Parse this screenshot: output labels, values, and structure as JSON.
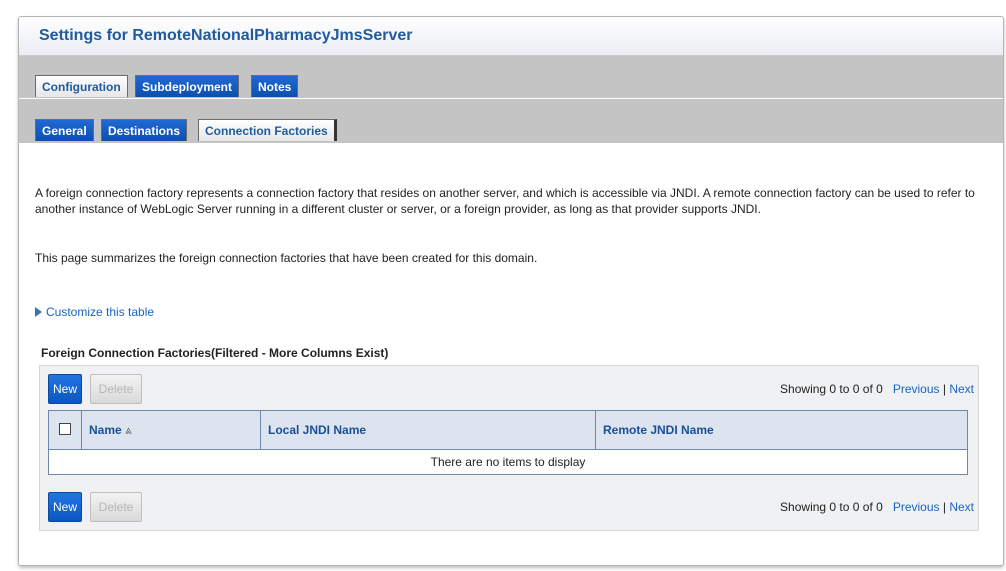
{
  "page_title": "Settings for RemoteNationalPharmacyJmsServer",
  "tabs_top": [
    {
      "label": "Configuration",
      "active": true
    },
    {
      "label": "Subdeployment",
      "active": false
    },
    {
      "label": "Notes",
      "active": false
    }
  ],
  "tabs_sub": [
    {
      "label": "General",
      "active": false
    },
    {
      "label": "Destinations",
      "active": false
    },
    {
      "label": "Connection Factories",
      "active": true
    }
  ],
  "description": "A foreign connection factory represents a connection factory that resides on another server, and which is accessible via JNDI. A remote connection factory can be used to refer to another instance of WebLogic Server running in a different cluster or server, or a foreign provider, as long as that provider supports JNDI.",
  "summary": "This page summarizes the foreign connection factories that have been created for this domain.",
  "customize_link": "Customize this table",
  "table": {
    "title": "Foreign Connection Factories(Filtered - More Columns Exist)",
    "new_label": "New",
    "delete_label": "Delete",
    "showing": "Showing 0 to 0 of 0",
    "previous": "Previous",
    "pipe": "|",
    "next": "Next",
    "columns": [
      "Name",
      "Local JNDI Name",
      "Remote JNDI Name"
    ],
    "sort_indicator": "⩓",
    "empty_message": "There are no items to display"
  },
  "colors": {
    "accent": "#1f5b9e",
    "tab_active_bg": "#ffffff",
    "tab_inactive_bg": "#0e4fae",
    "header_bg": "#dbe4ef"
  }
}
